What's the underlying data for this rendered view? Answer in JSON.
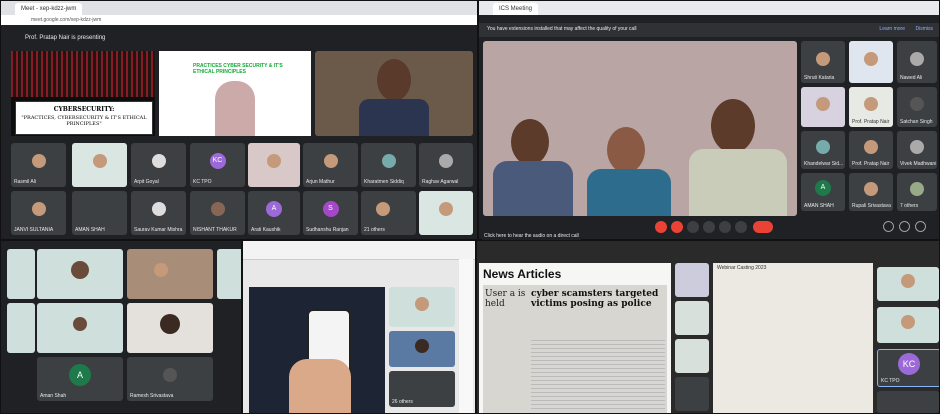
{
  "tl": {
    "browser_tab": "Meet - xep-kdzz-jwm",
    "url": "meet.google.com/xep-kdzz-jwm",
    "presenting": "Prof. Pratap Nair is presenting",
    "slide_title": "CYBERSECURITY:",
    "slide_subtitle": "\"PRACTICES, CYBERSECURITY & IT'S ETHICAL PRINCIPLES\"",
    "slide2_title": "PRACTICES CYBER SECURITY & IT'S ETHICAL PRINCIPLES",
    "names": [
      "Rasmil Ali",
      "Arpit Goyal",
      "KC TPO",
      "Arjun Mathur",
      "Kharatmen Siddiq",
      "Raghav Agarwal",
      "JANVI SULTANIA",
      "AMAN SHAH",
      "Saurav Kumar Mishra",
      "NISHANT THAKUR",
      "Arati Kaushik",
      "Sudhanshu Ranjan",
      "21 others"
    ],
    "kc": "KC",
    "a": "A",
    "s": "S"
  },
  "tr": {
    "browser_tab": "ICS Meeting",
    "warning": "You have extensions installed that may affect the quality of your call",
    "learn_more": "Learn more",
    "dismiss": "Dismiss",
    "names": [
      "Shruti Kataria",
      "Nawed Ali",
      "Prof. Pratap Nair",
      "Satchan Singh",
      "Khandelwar Sid...",
      "Prof. Pratap Nair",
      "Vivek Madhwani",
      "AMAN SHAH",
      "Rupali Srivastava",
      "7 others"
    ],
    "a": "A",
    "bottom_note": "Click here to hear the audio on a direct call"
  },
  "bl": {
    "names": [
      "Ramesh Srivastava",
      "Aman Shah"
    ],
    "a": "A"
  },
  "bm": {
    "others": "26 others"
  },
  "br": {
    "news_heading": "News Articles",
    "headline": "cyber scamsters targeted victims posing as police",
    "left_snippet": "User a is held",
    "window_title": "Webinar Casting 2023",
    "kc": "KC",
    "kc_name": "KC TPO"
  },
  "colors": {
    "bg": "#7a8a7c",
    "meet_dark": "#202124",
    "tile": "#3c4043",
    "end_call": "#ea4335",
    "avatar_purple": "#9c6ad8"
  }
}
